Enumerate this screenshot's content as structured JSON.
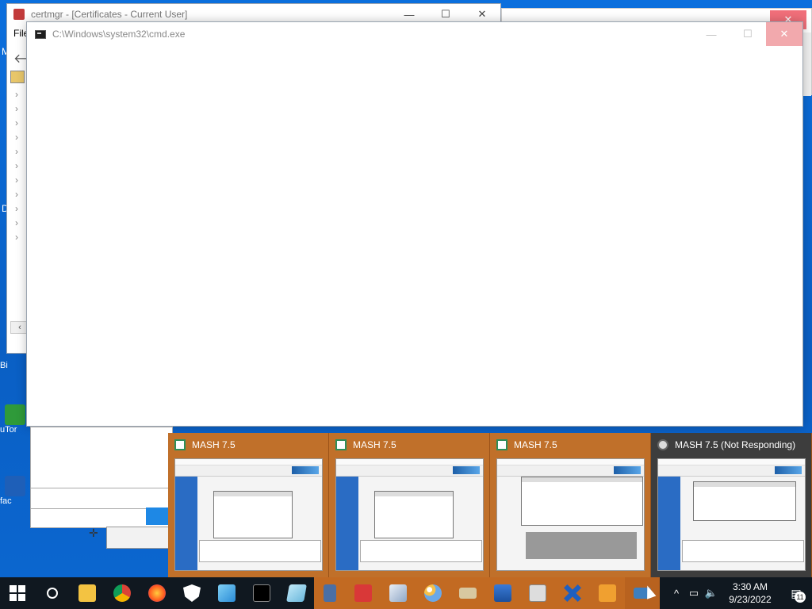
{
  "desktop": {
    "icons": [
      {
        "label": "Bi"
      },
      {
        "label": "uTor"
      },
      {
        "label": "fac"
      }
    ],
    "side_letters": {
      "m": "M",
      "d": "D"
    }
  },
  "certmgr": {
    "title": "certmgr - [Certificates - Current User]",
    "menu_file": "File",
    "minimize": "—",
    "maximize": "☐",
    "close": "✕"
  },
  "cmd": {
    "title": "C:\\Windows\\system32\\cmd.exe",
    "minimize": "—",
    "maximize": "☐",
    "close": "✕"
  },
  "previews": [
    {
      "title": "MASH 7.5"
    },
    {
      "title": "MASH 7.5"
    },
    {
      "title": "MASH 7.5"
    },
    {
      "title": "MASH 7.5 (Not Responding)"
    }
  ],
  "taskbar": {
    "items": [
      "start",
      "search",
      "file-explorer",
      "chrome",
      "firefox",
      "security",
      "photos",
      "cmd",
      "notepad",
      "calculator",
      "toolbox",
      "3d-viewer",
      "paint",
      "printer",
      "network",
      "package",
      "tools",
      "media",
      "mash"
    ],
    "clock_time": "3:30 AM",
    "clock_date": "9/23/2022",
    "notification_count": "11"
  },
  "colors": {
    "taskbar": "#101820",
    "active_item": "#c26a22",
    "preview_bg": "#b5631f",
    "desktop": "#0a6ad8"
  }
}
